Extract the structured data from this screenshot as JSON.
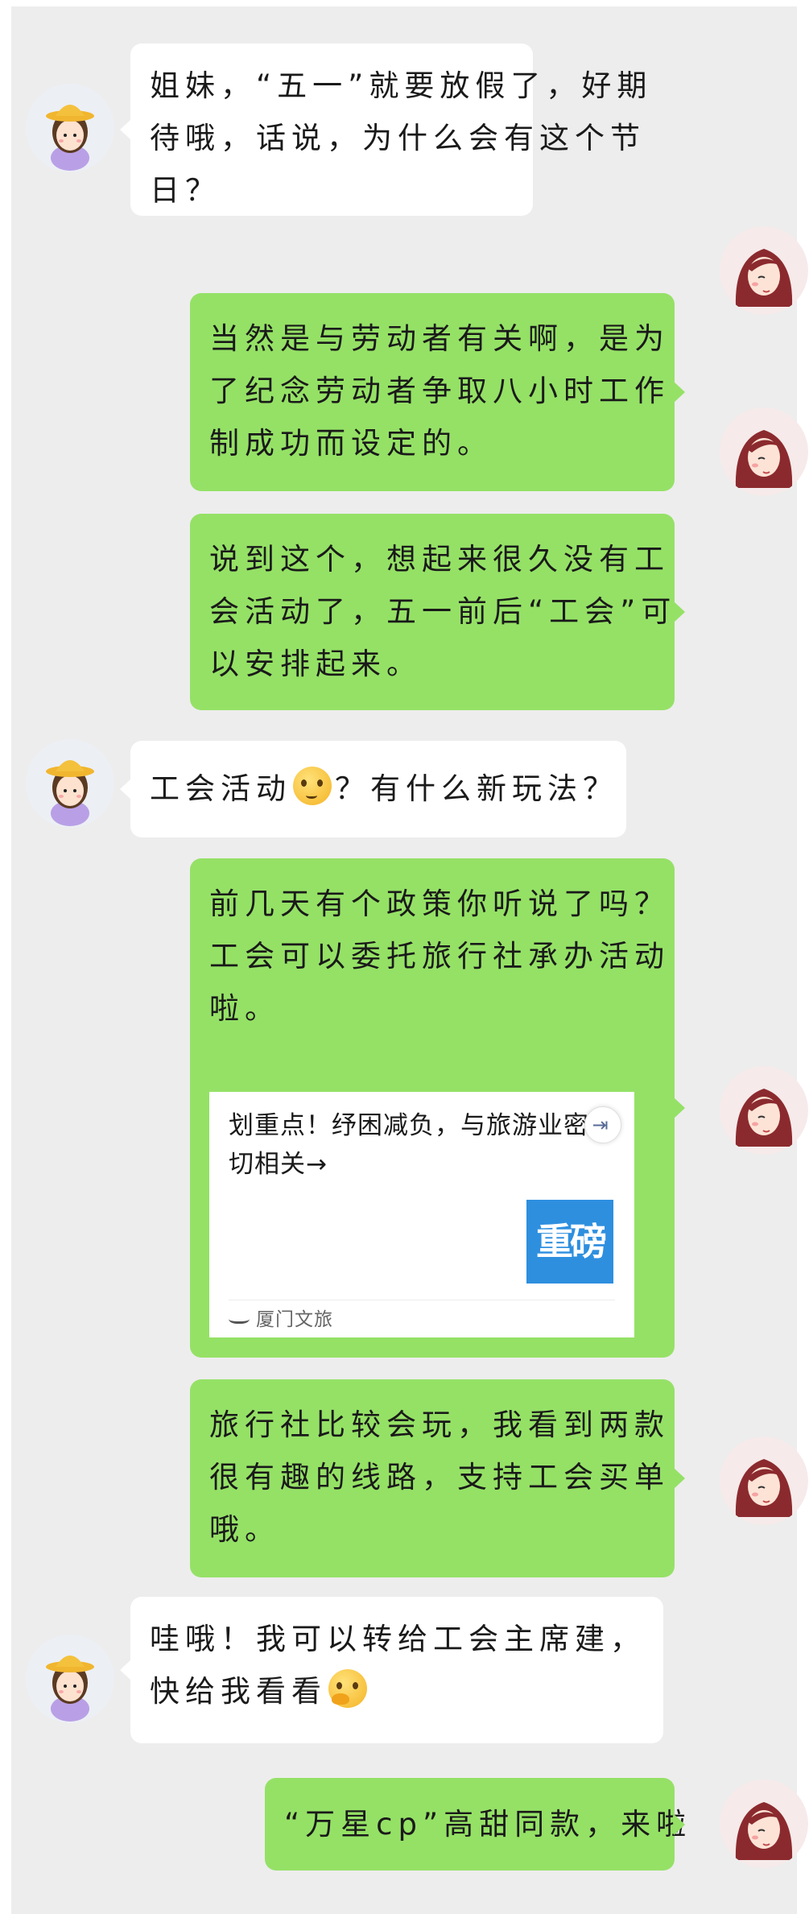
{
  "messages": [
    {
      "side": "left",
      "lines": [
        "姐妹，“五一”就要放假了，好期",
        "待哦，话说，为什么会有这个节",
        "日？"
      ]
    },
    {
      "side": "right",
      "lines": [
        "当然是与劳动者有关啊，是为",
        "了纪念劳动者争取八小时工作",
        "制成功而设定的。"
      ]
    },
    {
      "side": "right",
      "lines": [
        "说到这个，想起来很久没有工",
        "会活动了，五一前后“工会”可",
        "以安排起来。"
      ]
    },
    {
      "side": "left",
      "before_emoji": "工会活动",
      "emoji": "puzzled-face-icon",
      "after_emoji": "？有什么新玩法？"
    },
    {
      "side": "right",
      "lines": [
        "前几天有个政策你听说了吗？",
        "工会可以委托旅行社承办活动",
        "啦。"
      ],
      "card": {
        "title_line1": "划重点！纾困减负，与旅游业密",
        "title_line2": "切相关→",
        "thumb_text": "重磅",
        "source": "厦门文旅",
        "share_icon": "share-icon"
      }
    },
    {
      "side": "right",
      "lines": [
        "旅行社比较会玩，我看到两款",
        "很有趣的线路，支持工会买单",
        "哦。"
      ]
    },
    {
      "side": "left",
      "line1": "哇哦！我可以转给工会主席建，",
      "line2_text": "快给我看看",
      "emoji": "thinking-face-icon"
    },
    {
      "side": "right",
      "lines": [
        "“万星cp”高甜同款，来啦"
      ]
    }
  ],
  "colors": {
    "background": "#ededed",
    "green_bubble": "#95e166",
    "white_bubble": "#ffffff"
  }
}
